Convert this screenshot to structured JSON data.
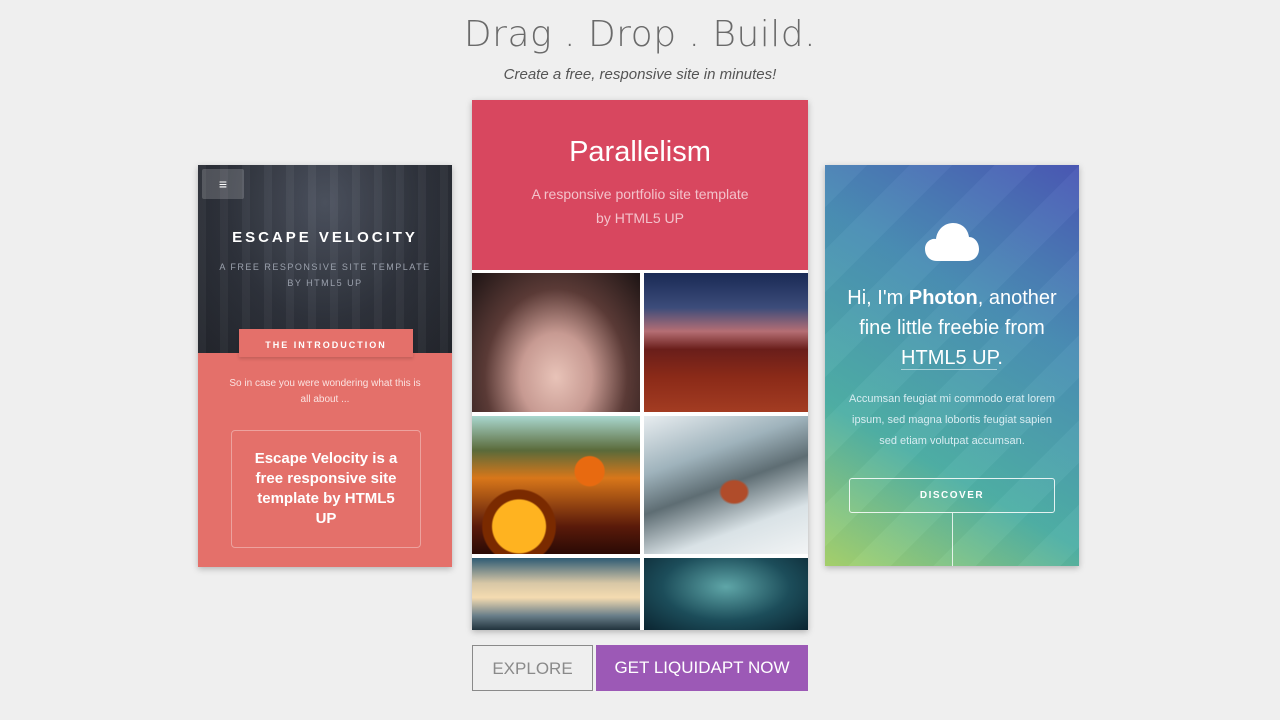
{
  "header": {
    "title": "Drag . Drop . Build.",
    "subtitle": "Create a free, responsive site in minutes!"
  },
  "cards": {
    "escape_velocity": {
      "menu_icon": "hamburger-icon",
      "menu_glyph": "≡",
      "name": "ESCAPE VELOCITY",
      "tagline": "A FREE RESPONSIVE SITE TEMPLATE BY HTML5 UP",
      "intro_label": "THE INTRODUCTION",
      "intro_text": "So in case you were wondering what this is all about ...",
      "box_text": "Escape Velocity is a free responsive site template by HTML5 UP",
      "colors": {
        "top": "#2f333c",
        "accent": "#e4706a"
      }
    },
    "parallelism": {
      "name": "Parallelism",
      "description": "A responsive portfolio site template by HTML5 UP",
      "gallery": [
        "woman-face-photo",
        "red-hills-photo",
        "sunflowers-photo",
        "woman-in-tree-photo",
        "wind-turbines-photo",
        "glowing-tree-photo"
      ],
      "colors": {
        "accent": "#d8475f"
      }
    },
    "photon": {
      "icon": "cloud-icon",
      "greeting": "Hi, I'm ",
      "name": "Photon",
      "after_name": ", another fine little freebie from ",
      "link": "HTML5 UP",
      "period": ".",
      "body": "Accumsan feugiat mi commodo erat lorem ipsum, sed magna lobortis feugiat sapien sed etiam volutpat accumsan.",
      "button": "DISCOVER"
    }
  },
  "actions": {
    "explore": "EXPLORE",
    "get_now": "GET LIQUIDAPT NOW",
    "colors": {
      "get_now_bg": "#9c59b6"
    }
  }
}
